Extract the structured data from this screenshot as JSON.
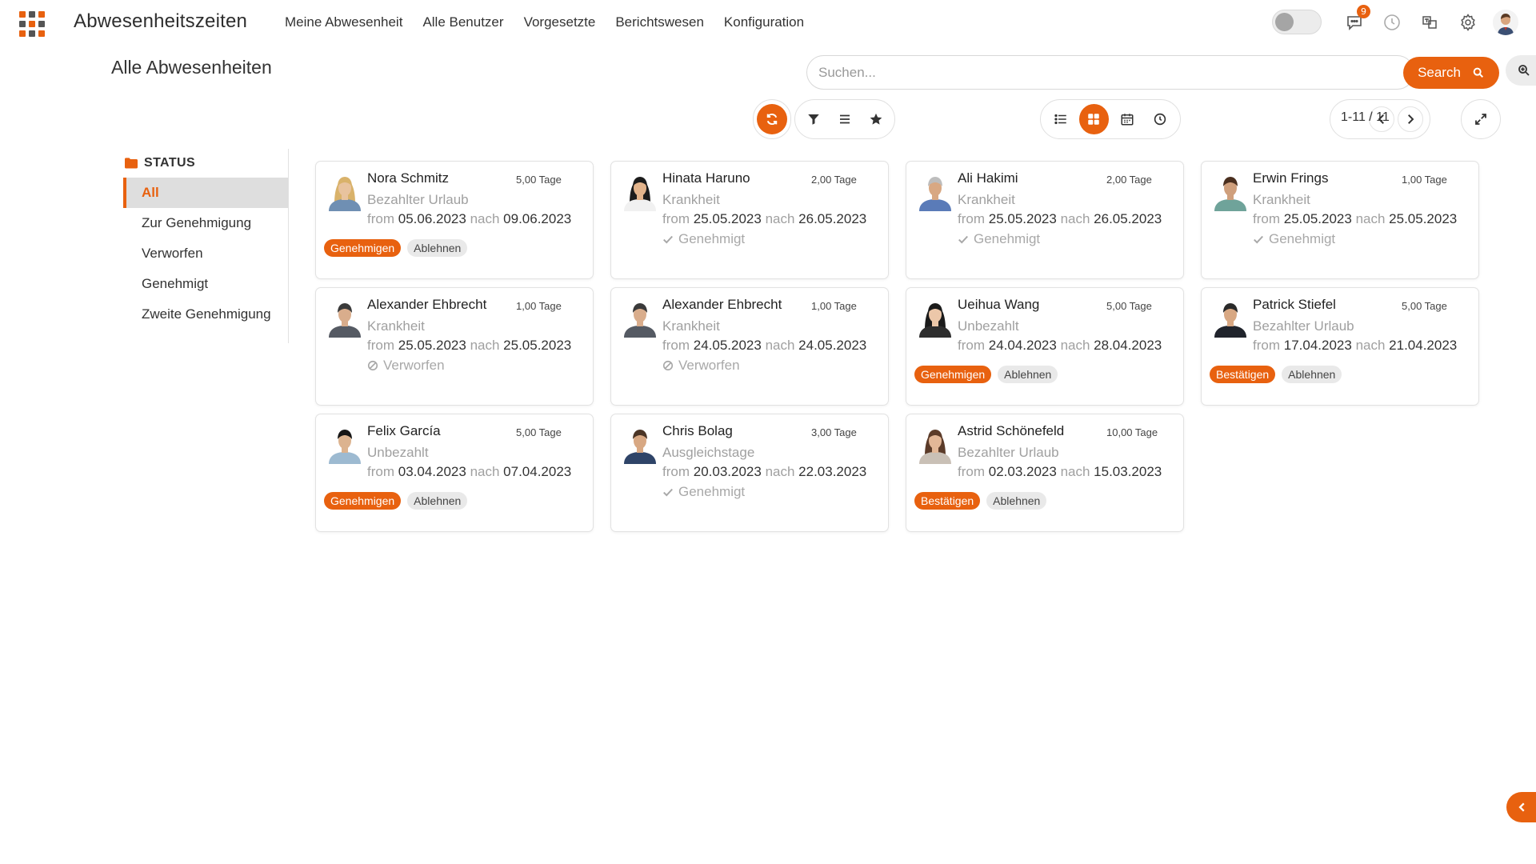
{
  "app": {
    "title": "Abwesenheitszeiten"
  },
  "menu": [
    "Meine Abwesenheit",
    "Alle Benutzer",
    "Vorgesetzte",
    "Berichtswesen",
    "Konfiguration"
  ],
  "topbar": {
    "message_badge": "9"
  },
  "page": {
    "title": "Alle Abwesenheiten"
  },
  "search": {
    "placeholder": "Suchen...",
    "button_label": "Search"
  },
  "pager": {
    "text": "1-11 / 11"
  },
  "sidebar": {
    "header": "STATUS",
    "items": [
      "All",
      "Zur Genehmigung",
      "Verworfen",
      "Genehmigt",
      "Zweite Genehmigung"
    ],
    "active": "All"
  },
  "labels": {
    "from": "from",
    "to": "nach"
  },
  "colors": {
    "accent": "#e8610f"
  },
  "cards": [
    {
      "name": "Nora Schmitz",
      "days": "5,00 Tage",
      "type": "Bezahlter Urlaub",
      "from": "05.06.2023",
      "to": "09.06.2023",
      "approve": "Genehmigen",
      "refuse": "Ablehnen"
    },
    {
      "name": "Hinata Haruno",
      "days": "2,00 Tage",
      "type": "Krankheit",
      "from": "25.05.2023",
      "to": "26.05.2023",
      "state": "Genehmigt"
    },
    {
      "name": "Ali Hakimi",
      "days": "2,00 Tage",
      "type": "Krankheit",
      "from": "25.05.2023",
      "to": "26.05.2023",
      "state": "Genehmigt"
    },
    {
      "name": "Erwin Frings",
      "days": "1,00 Tage",
      "type": "Krankheit",
      "from": "25.05.2023",
      "to": "25.05.2023",
      "state": "Genehmigt"
    },
    {
      "name": "Alexander Ehbrecht",
      "days": "1,00 Tage",
      "type": "Krankheit",
      "from": "25.05.2023",
      "to": "25.05.2023",
      "state": "Verworfen"
    },
    {
      "name": "Alexander Ehbrecht",
      "days": "1,00 Tage",
      "type": "Krankheit",
      "from": "24.05.2023",
      "to": "24.05.2023",
      "state": "Verworfen"
    },
    {
      "name": "Ueihua Wang",
      "days": "5,00 Tage",
      "type": "Unbezahlt",
      "from": "24.04.2023",
      "to": "28.04.2023",
      "approve": "Genehmigen",
      "refuse": "Ablehnen"
    },
    {
      "name": "Patrick Stiefel",
      "days": "5,00 Tage",
      "type": "Bezahlter Urlaub",
      "from": "17.04.2023",
      "to": "21.04.2023",
      "approve": "Bestätigen",
      "refuse": "Ablehnen"
    },
    {
      "name": "Felix García",
      "days": "5,00 Tage",
      "type": "Unbezahlt",
      "from": "03.04.2023",
      "to": "07.04.2023",
      "approve": "Genehmigen",
      "refuse": "Ablehnen"
    },
    {
      "name": "Chris Bolag",
      "days": "3,00 Tage",
      "type": "Ausgleichstage",
      "from": "20.03.2023",
      "to": "22.03.2023",
      "state": "Genehmigt"
    },
    {
      "name": "Astrid Schönefeld",
      "days": "10,00 Tage",
      "type": "Bezahlter Urlaub",
      "from": "02.03.2023",
      "to": "15.03.2023",
      "approve": "Bestätigen",
      "refuse": "Ablehnen"
    }
  ]
}
